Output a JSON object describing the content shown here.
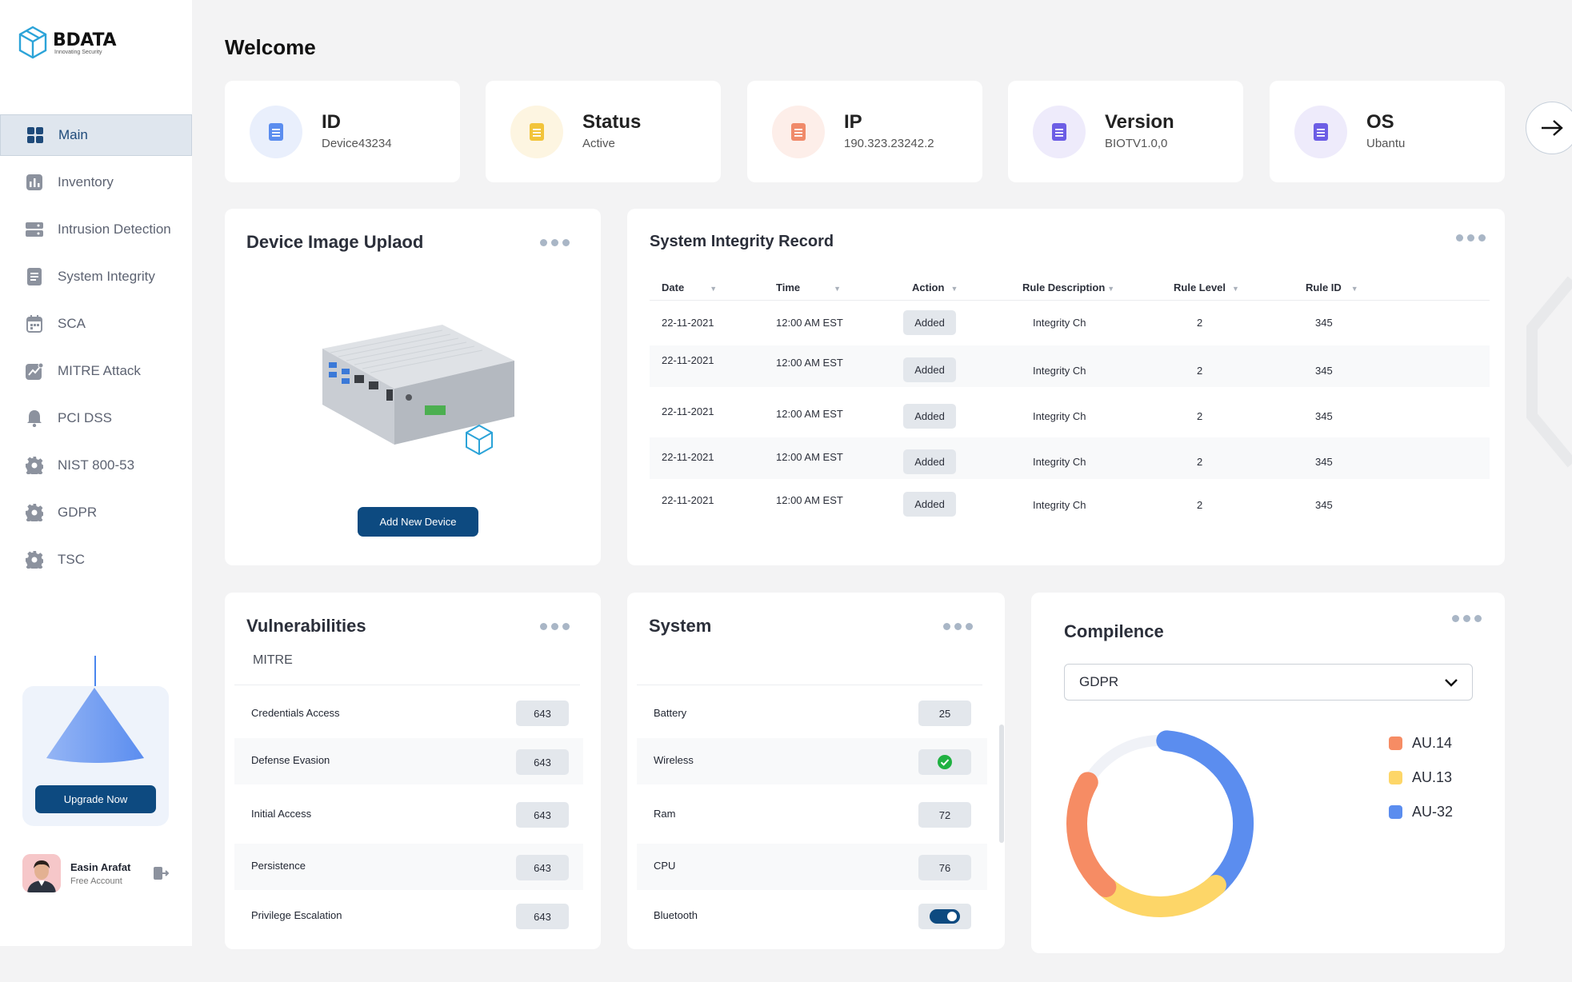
{
  "brand": {
    "name": "BDATA",
    "tagline": "Innovating Security"
  },
  "nav": {
    "items": [
      {
        "label": "Main",
        "icon": "grid-icon",
        "active": true
      },
      {
        "label": "Inventory",
        "icon": "bar-chart-icon"
      },
      {
        "label": "Intrusion Detection",
        "icon": "server-icon"
      },
      {
        "label": "System Integrity",
        "icon": "document-icon"
      },
      {
        "label": "SCA",
        "icon": "calendar-icon"
      },
      {
        "label": "MITRE Attack",
        "icon": "trend-icon"
      },
      {
        "label": "PCI DSS",
        "icon": "bell-icon"
      },
      {
        "label": "NIST 800-53",
        "icon": "gear-icon"
      },
      {
        "label": "GDPR",
        "icon": "gear-icon"
      },
      {
        "label": "TSC",
        "icon": "gear-icon"
      }
    ]
  },
  "upgrade": {
    "button": "Upgrade Now"
  },
  "user": {
    "name": "Easin Arafat",
    "plan": "Free Account"
  },
  "page": {
    "title": "Welcome"
  },
  "stats": [
    {
      "title": "ID",
      "value": "Device43234",
      "bg": "#e9effc",
      "fg": "#5b8def"
    },
    {
      "title": "Status",
      "value": "Active",
      "bg": "#fdf5e1",
      "fg": "#f2c43a"
    },
    {
      "title": "IP",
      "value": "190.323.23242.2",
      "bg": "#fdeee9",
      "fg": "#f08a6a"
    },
    {
      "title": "Version",
      "value": "BIOTV1.0,0",
      "bg": "#eeebfb",
      "fg": "#6c5de5"
    },
    {
      "title": "OS",
      "value": "Ubantu",
      "bg": "#eeebfb",
      "fg": "#6c5de5"
    }
  ],
  "device": {
    "title": "Device Image Uplaod",
    "button": "Add New Device"
  },
  "integrity": {
    "title": "System Integrity Record",
    "columns": [
      "Date",
      "Time",
      "Action",
      "Rule Description",
      "Rule Level",
      "Rule ID"
    ],
    "rows": [
      {
        "date": "22-11-2021",
        "time": "12:00 AM EST",
        "action": "Added",
        "desc": "Integrity Ch",
        "level": "2",
        "id": "345"
      },
      {
        "date": "22-11-2021",
        "time": "12:00 AM EST",
        "action": "Added",
        "desc": "Integrity Ch",
        "level": "2",
        "id": "345"
      },
      {
        "date": "22-11-2021",
        "time": "12:00 AM EST",
        "action": "Added",
        "desc": "Integrity Ch",
        "level": "2",
        "id": "345"
      },
      {
        "date": "22-11-2021",
        "time": "12:00 AM EST",
        "action": "Added",
        "desc": "Integrity Ch",
        "level": "2",
        "id": "345"
      },
      {
        "date": "22-11-2021",
        "time": "12:00 AM EST",
        "action": "Added",
        "desc": "Integrity Ch",
        "level": "2",
        "id": "345"
      }
    ]
  },
  "vulnerabilities": {
    "title": "Vulnerabilities",
    "subtitle": "MITRE",
    "rows": [
      {
        "label": "Credentials Access",
        "value": "643"
      },
      {
        "label": "Defense Evasion",
        "value": "643"
      },
      {
        "label": "Initial Access",
        "value": "643"
      },
      {
        "label": "Persistence",
        "value": "643"
      },
      {
        "label": "Privilege Escalation",
        "value": "643"
      }
    ]
  },
  "system": {
    "title": "System",
    "rows": [
      {
        "label": "Battery",
        "value": "25"
      },
      {
        "label": "Wireless",
        "value": "",
        "status": "check-icon"
      },
      {
        "label": "Ram",
        "value": "72"
      },
      {
        "label": "CPU",
        "value": "76"
      },
      {
        "label": "Bluetooth",
        "value": "",
        "toggle": true
      }
    ]
  },
  "compliance": {
    "title": "Compilence",
    "selected": "GDPR",
    "legend": [
      {
        "label": "AU.14",
        "color": "#f68c64"
      },
      {
        "label": "AU.13",
        "color": "#fdd668"
      },
      {
        "label": "AU-32",
        "color": "#5b8def"
      }
    ],
    "shares": {
      "AU.14": 0.22,
      "AU.13": 0.23,
      "AU-32": 0.37
    }
  }
}
